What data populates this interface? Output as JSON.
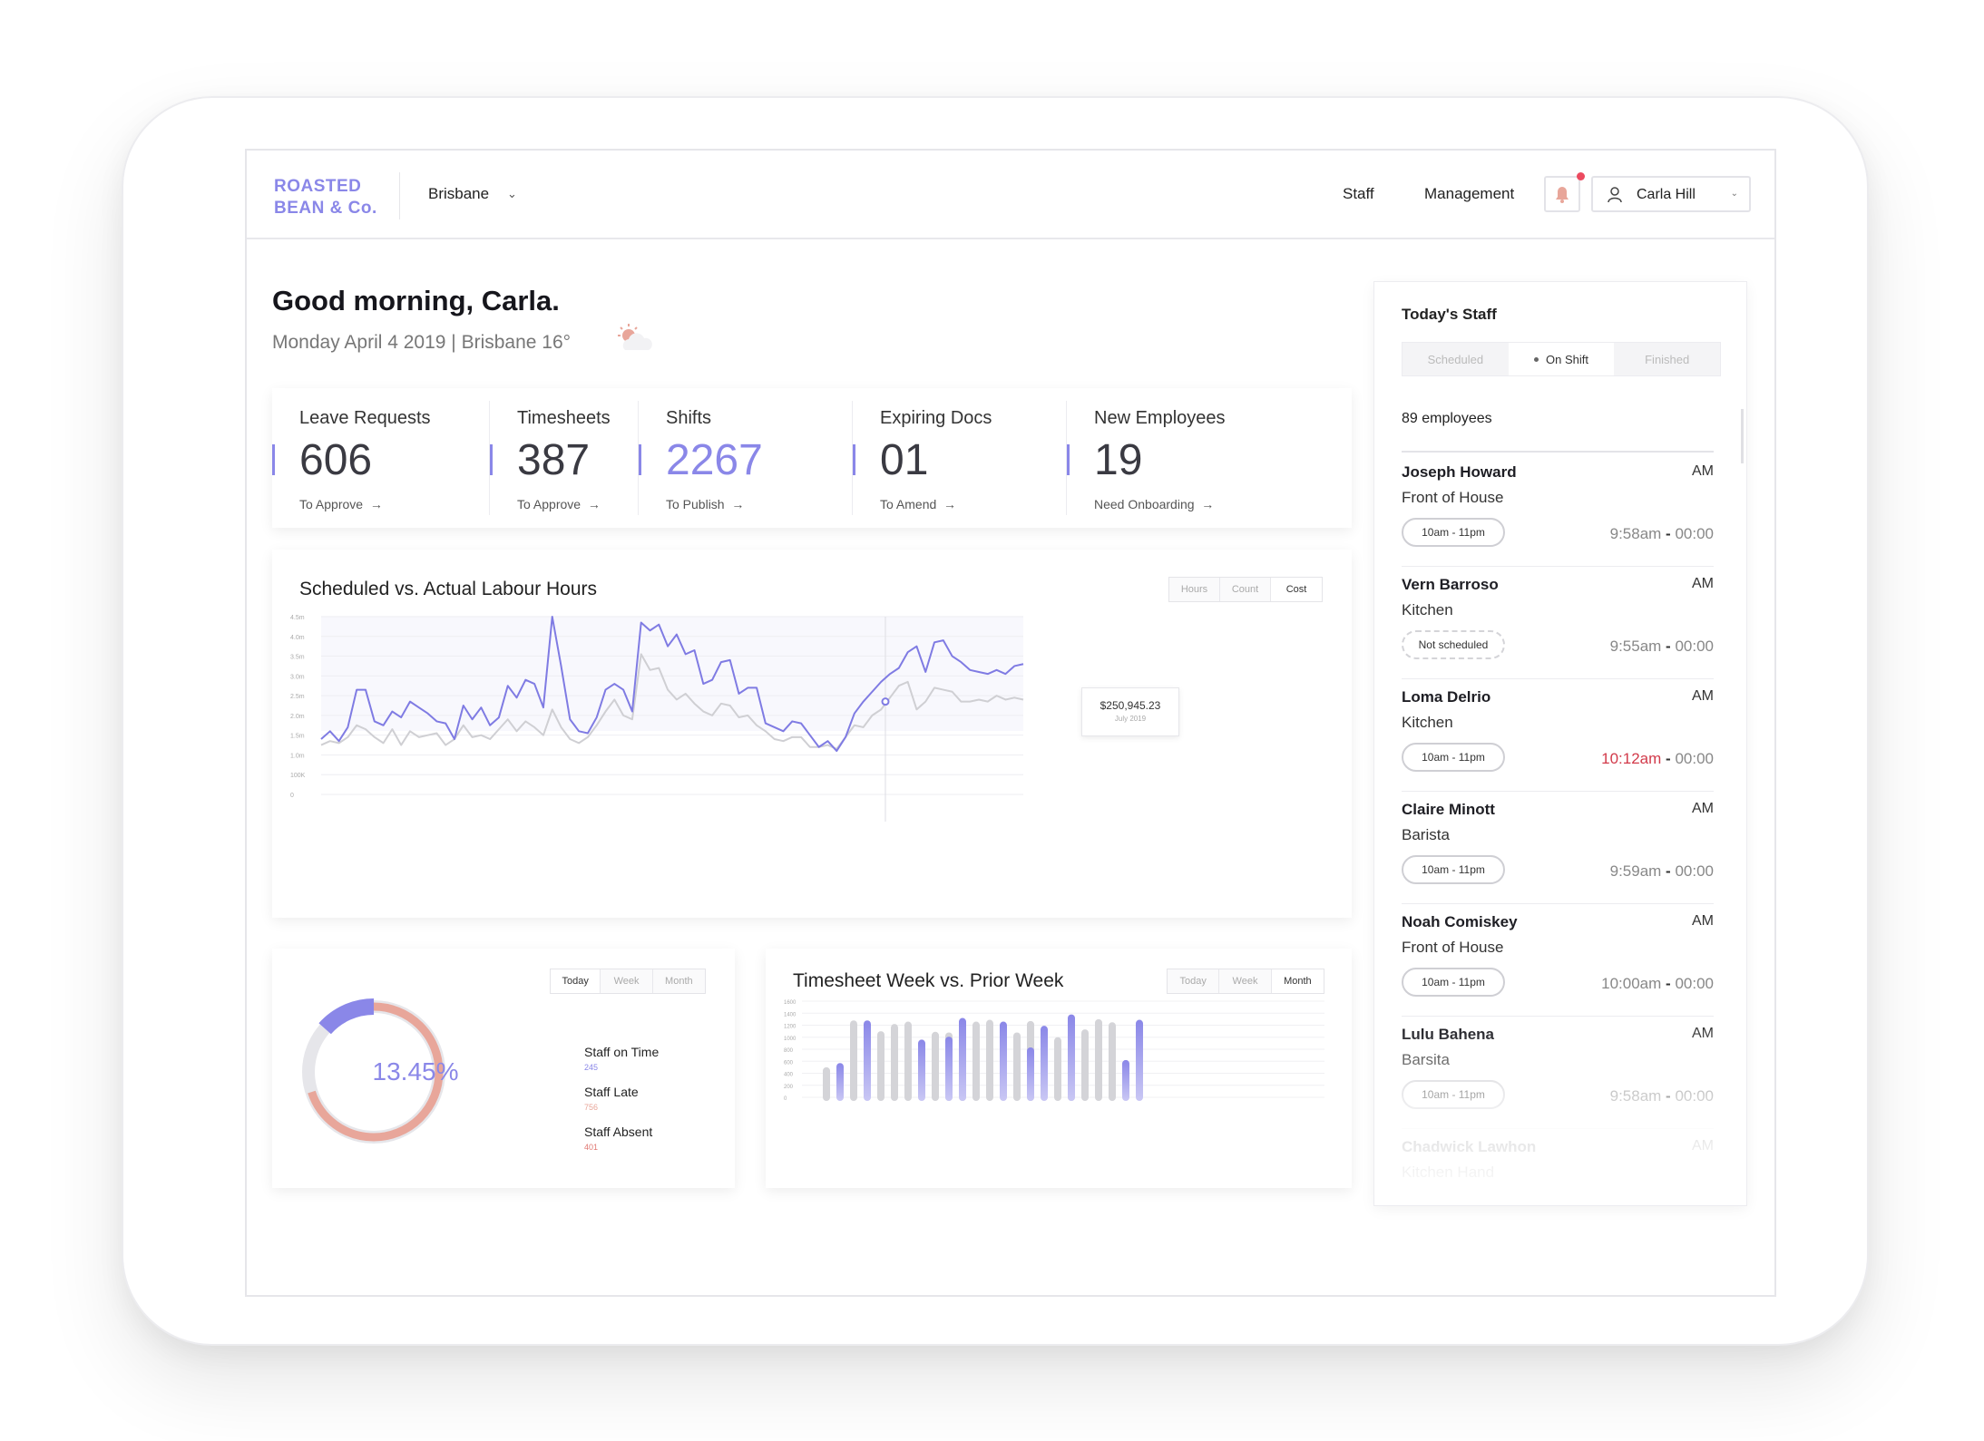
{
  "header": {
    "brand": "ROASTED\nBEAN & Co.",
    "city": "Brisbane",
    "nav": [
      "Staff",
      "Management"
    ],
    "user": "Carla Hill"
  },
  "greeting": {
    "title": "Good morning, Carla.",
    "subtitle": "Monday April 4 2019  |  Brisbane 16°"
  },
  "stats": [
    {
      "label": "Leave Requests",
      "value": "606",
      "action": "To Approve",
      "accent": false
    },
    {
      "label": "Timesheets",
      "value": "387",
      "action": "To Approve",
      "accent": false
    },
    {
      "label": "Shifts",
      "value": "2267",
      "action": "To Publish",
      "accent": true
    },
    {
      "label": "Expiring Docs",
      "value": "01",
      "action": "To Amend",
      "accent": false
    },
    {
      "label": "New Employees",
      "value": "19",
      "action": "Need Onboarding",
      "accent": false
    }
  ],
  "labour_chart": {
    "title": "Scheduled vs. Actual Labour Hours",
    "tabs": [
      "Hours",
      "Count",
      "Cost"
    ],
    "active_tab": "Cost",
    "tooltip_value": "$250,945.23",
    "tooltip_date": "July 2019"
  },
  "donut": {
    "tabs": [
      "Today",
      "Week",
      "Month"
    ],
    "active_tab": "Today",
    "value_label": "13.45%",
    "fraction": 0.1345,
    "legend": [
      {
        "label": "Staff on Time",
        "value": "245",
        "color": "#8a87e8"
      },
      {
        "label": "Staff Late",
        "value": "756",
        "color": "#e8a69a"
      },
      {
        "label": "Staff Absent",
        "value": "401",
        "color": "#e07872"
      }
    ]
  },
  "timesheet_chart": {
    "title": "Timesheet Week vs. Prior Week",
    "tabs": [
      "Today",
      "Week",
      "Month"
    ],
    "active_tab": "Month"
  },
  "todays_staff": {
    "title": "Today's Staff",
    "tabs": [
      "Scheduled",
      "On Shift",
      "Finished"
    ],
    "active_tab": "On Shift",
    "count_label": "89 employees",
    "rows": [
      {
        "name": "Joseph Howard",
        "period": "AM",
        "role": "Front of House",
        "shift": "10am - 11pm",
        "clock_in": "9:58am",
        "clock_out": "00:00",
        "late": false
      },
      {
        "name": "Vern Barroso",
        "period": "AM",
        "role": "Kitchen",
        "shift": "Not scheduled",
        "clock_in": "9:55am",
        "clock_out": "00:00",
        "late": false
      },
      {
        "name": "Loma Delrio",
        "period": "AM",
        "role": "Kitchen",
        "shift": "10am - 11pm",
        "clock_in": "10:12am",
        "clock_out": "00:00",
        "late": true
      },
      {
        "name": "Claire Minott",
        "period": "AM",
        "role": "Barista",
        "shift": "10am - 11pm",
        "clock_in": "9:59am",
        "clock_out": "00:00",
        "late": false
      },
      {
        "name": "Noah Comiskey",
        "period": "AM",
        "role": "Front of House",
        "shift": "10am - 11pm",
        "clock_in": "10:00am",
        "clock_out": "00:00",
        "late": false
      },
      {
        "name": "Lulu Bahena",
        "period": "AM",
        "role": "Barsita",
        "shift": "10am - 11pm",
        "clock_in": "9:58am",
        "clock_out": "00:00",
        "late": false
      },
      {
        "name": "Chadwick Lawhon",
        "period": "AM",
        "role": "Kitchen Hand",
        "shift": "",
        "clock_in": "",
        "clock_out": "",
        "late": false
      }
    ]
  },
  "colors": {
    "accent": "#8a87e8",
    "late": "#d23a4a",
    "scheduled_line": "#cfcfd3",
    "actual_line": "#7f7be3"
  },
  "chart_data": [
    {
      "type": "line",
      "title": "Scheduled vs. Actual Labour Hours",
      "y_tick_labels": [
        "0",
        "100K",
        "1.0m",
        "1.5m",
        "2.0m",
        "2.5m",
        "3.0m",
        "3.5m",
        "4.0m",
        "4.5m"
      ],
      "ylim": [
        0,
        9
      ],
      "grid": true,
      "series": [
        {
          "values": [
            2.8,
            3.2,
            2.7,
            3.4,
            5.3,
            5.3,
            3.7,
            3.5,
            4.2,
            3.9,
            4.7,
            4.4,
            4.1,
            3.7,
            3.6,
            2.8,
            4.5,
            3.8,
            4.4,
            3.5,
            3.9,
            5.5,
            4.9,
            5.8,
            5.6,
            4.4,
            9.0,
            6.5,
            3.8,
            3.2,
            3.1,
            3.9,
            5.3,
            5.6,
            5.3,
            4.2,
            8.7,
            8.3,
            8.6,
            7.5,
            8.1,
            7.1,
            7.3,
            5.6,
            5.8,
            6.7,
            6.8,
            5.1,
            5.4,
            5.4,
            3.6,
            3.4,
            3.2,
            3.7,
            3.6,
            3.0,
            2.4,
            2.7,
            2.2,
            2.9,
            4.1,
            4.7,
            5.2,
            5.7,
            6.1,
            6.4,
            7.2,
            7.5,
            6.2,
            7.7,
            7.8,
            7.0,
            6.7,
            6.3,
            6.2,
            6.1,
            6.3,
            6.1,
            6.5,
            6.6
          ]
        },
        {
          "values": [
            2.5,
            2.7,
            2.6,
            2.9,
            3.5,
            3.3,
            2.9,
            2.6,
            3.3,
            2.5,
            3.2,
            2.9,
            3.0,
            3.1,
            2.5,
            2.8,
            3.5,
            2.9,
            3.0,
            2.8,
            3.3,
            3.8,
            3.2,
            3.7,
            3.4,
            3.0,
            4.3,
            3.4,
            2.8,
            2.6,
            2.9,
            3.5,
            4.2,
            4.8,
            4.0,
            3.8,
            7.1,
            6.3,
            6.4,
            5.3,
            4.8,
            5.1,
            4.6,
            4.2,
            4.0,
            4.6,
            4.5,
            3.9,
            4.0,
            3.5,
            3.2,
            2.8,
            2.7,
            2.9,
            2.9,
            2.4,
            2.4,
            2.5,
            2.3,
            2.9,
            3.5,
            3.4,
            4.0,
            4.3,
            4.9,
            5.5,
            5.7,
            4.3,
            4.7,
            5.4,
            5.3,
            5.2,
            4.7,
            4.7,
            4.8,
            4.7,
            5.0,
            4.8,
            4.9,
            4.8
          ]
        }
      ]
    },
    {
      "type": "pie",
      "values": [
        13.45,
        86.55
      ]
    },
    {
      "type": "bar",
      "y_tick_labels": [
        "0",
        "200",
        "400",
        "600",
        "800",
        "1000",
        "1200",
        "1400",
        "1600"
      ],
      "ylim": [
        0,
        1600
      ],
      "grid": true,
      "series": [
        {
          "values": [
            500,
            1280,
            1100,
            1220,
            1260,
            1090,
            1080,
            1010,
            1260,
            1290,
            1080,
            1270,
            1000,
            1080,
            1130,
            1300,
            1250
          ]
        },
        {
          "values": [
            570,
            1280,
            960,
            1010,
            1320,
            1260,
            830,
            1190,
            1380,
            620,
            1290
          ]
        }
      ]
    }
  ]
}
